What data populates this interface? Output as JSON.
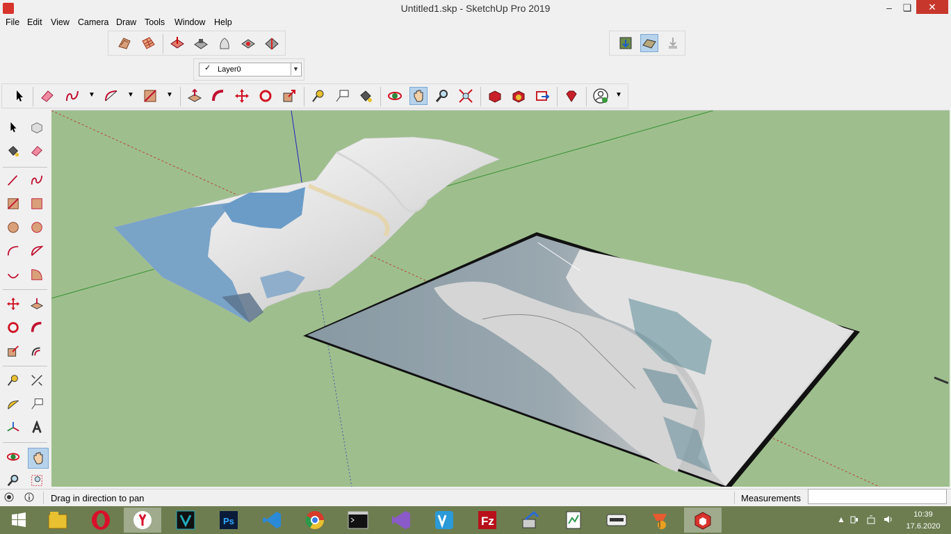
{
  "window": {
    "title": "Untitled1.skp - SketchUp Pro 2019",
    "minimize": "–",
    "maximize": "❏",
    "close": "✕"
  },
  "menu": [
    "File",
    "Edit",
    "View",
    "Camera",
    "Draw",
    "Tools",
    "Window",
    "Help"
  ],
  "layers": {
    "current": "Layer0",
    "check": "✓",
    "arrow": "▼"
  },
  "status": {
    "hint": "Drag in direction to pan",
    "measurements_label": "Measurements",
    "measurements_value": ""
  },
  "clock": {
    "time": "10:39",
    "date": "17.6.2020"
  },
  "taskbar": {
    "apps": [
      "windows-start",
      "file-explorer",
      "opera",
      "yandex",
      "vectorworks",
      "photoshop",
      "vscode",
      "chrome",
      "command-prompt",
      "visual-studio",
      "vectr",
      "filezilla",
      "network-tool",
      "notepad",
      "printer-app",
      "fruit-app",
      "sketchup"
    ]
  },
  "colors": {
    "viewport_bg": "#9ebf8d",
    "accent": "#b7d3ec",
    "taskbar": "#6d7d50",
    "close_btn": "#c7372c"
  }
}
